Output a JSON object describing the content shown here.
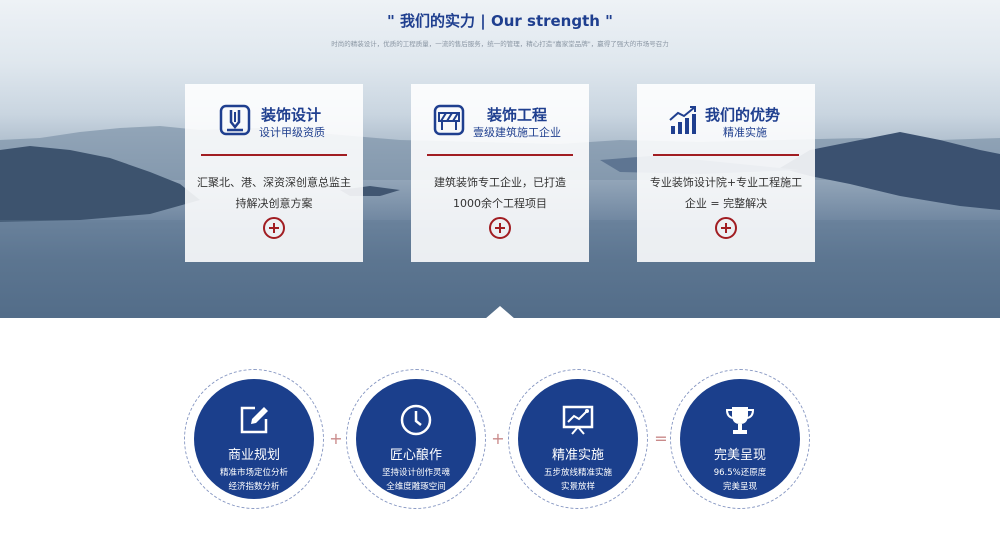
{
  "header": {
    "title": "\" 我们的实力 | Our strength \"",
    "subtitle": "时尚的精装设计，优质的工程质量，一流的售后服务，统一的管理，精心打造\"嘉家堂品牌\"，赢得了强大的市场号召力"
  },
  "cards": [
    {
      "icon": "pencil-download-icon",
      "title": "装饰设计",
      "subtitle": "设计甲级资质",
      "text_1": "汇聚北、港、深资深创意总监主",
      "text_2": "持解决创意方案"
    },
    {
      "icon": "construction-barrier-icon",
      "title": "装饰工程",
      "subtitle": "壹级建筑施工企业",
      "text_1": "建筑装饰专工企业，已打造",
      "text_2": "1000余个工程项目"
    },
    {
      "icon": "bar-chart-trend-icon",
      "title": "我们的优势",
      "subtitle": "精准实施",
      "text_1": "专业装饰设计院+专业工程施工",
      "text_2": "企业 = 完整解决"
    }
  ],
  "steps": [
    {
      "icon": "edit-icon",
      "title": "商业规划",
      "line_1": "精准市场定位分析",
      "line_2": "经济指数分析"
    },
    {
      "icon": "clock-icon",
      "title": "匠心酿作",
      "line_1": "坚持设计创作灵魂",
      "line_2": "全维度雕琢空间"
    },
    {
      "icon": "presentation-chart-icon",
      "title": "精准实施",
      "line_1": "五步放线精准实施",
      "line_2": "实景放样"
    },
    {
      "icon": "trophy-icon",
      "title": "完美呈现",
      "line_1": "96.5%还原度",
      "line_2": "完美呈现"
    }
  ],
  "operators": [
    "+",
    "+",
    "="
  ],
  "colors": {
    "brand_blue": "#1b3f8c",
    "accent_red": "#a11d22"
  }
}
